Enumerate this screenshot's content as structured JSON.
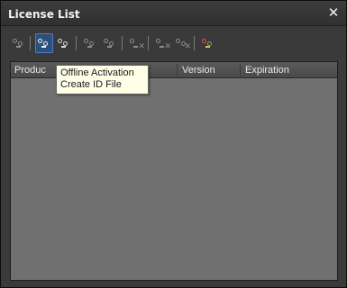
{
  "window": {
    "title": "License List",
    "close_glyph": "✕"
  },
  "toolbar": {
    "buttons": [
      {
        "icon": "license-icon",
        "state": "normal"
      },
      {
        "icon": "offline-activation-icon",
        "state": "active"
      },
      {
        "icon": "license-info-icon",
        "state": "normal"
      },
      {
        "icon": "license-disabled-icon",
        "state": "normal"
      },
      {
        "icon": "license-disabled-icon",
        "state": "normal"
      },
      {
        "icon": "remove-license-icon",
        "state": "normal"
      },
      {
        "icon": "remove-license-icon",
        "state": "normal"
      },
      {
        "icon": "remove-license-icon",
        "state": "normal"
      },
      {
        "icon": "online-license-icon",
        "state": "normal"
      }
    ]
  },
  "list": {
    "columns": [
      "Produc",
      "Version",
      "Expiration"
    ],
    "rows": []
  },
  "tooltip": {
    "line1": "Offline Activation",
    "line2": "Create ID File"
  },
  "colors": {
    "accent": "#2d4f7a",
    "list_background": "#707070",
    "tooltip_background": "#ffffe8"
  }
}
